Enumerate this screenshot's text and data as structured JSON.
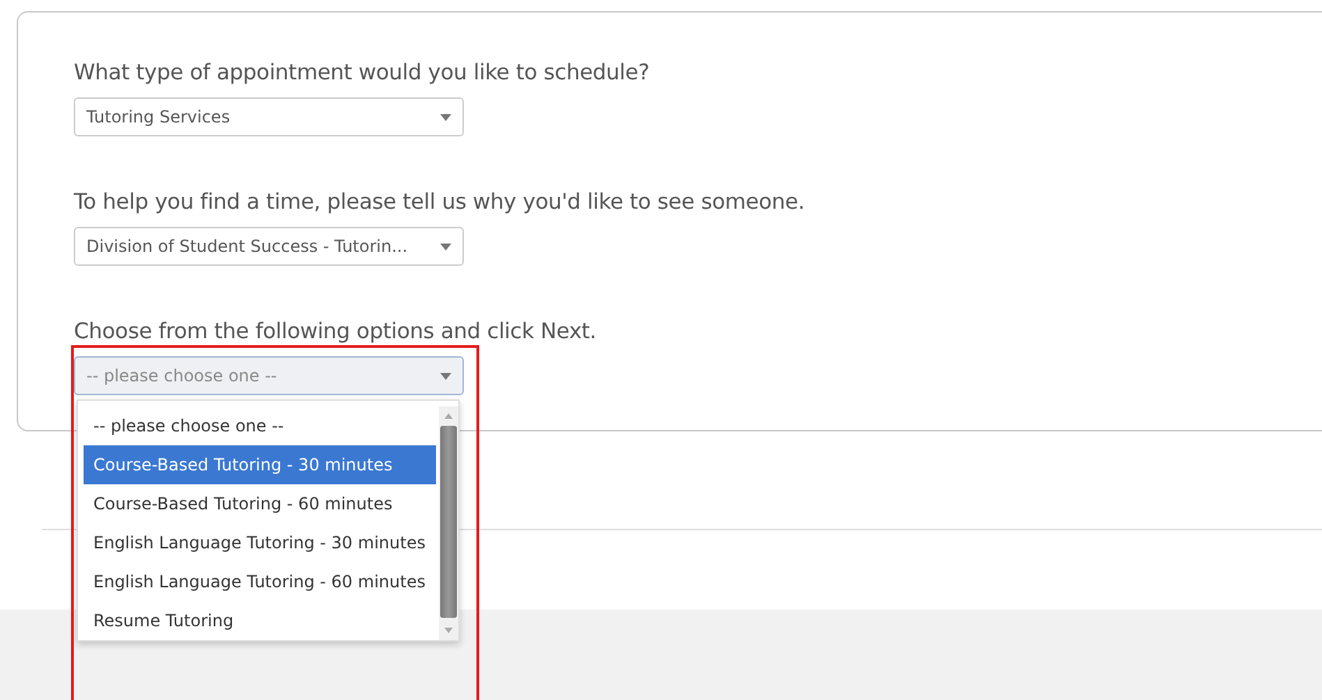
{
  "questions": [
    {
      "label": "What type of appointment would you like to schedule?",
      "select": {
        "value": "Tutoring Services",
        "open": false
      }
    },
    {
      "label": "To help you find a time, please tell us why you'd like to see someone.",
      "select": {
        "value": "Division of Student Success - Tutorin...",
        "open": false
      }
    },
    {
      "label": "Choose from the following options and click Next.",
      "select": {
        "placeholder": "-- please choose one --",
        "open": true,
        "options": [
          {
            "label": "-- please choose one --",
            "selected": false
          },
          {
            "label": "Course-Based Tutoring - 30 minutes",
            "selected": true
          },
          {
            "label": "Course-Based Tutoring - 60 minutes",
            "selected": false
          },
          {
            "label": "English Language Tutoring - 30 minutes",
            "selected": false
          },
          {
            "label": "English Language Tutoring - 60 minutes",
            "selected": false
          },
          {
            "label": "Resume Tutoring",
            "selected": false
          }
        ]
      }
    }
  ]
}
